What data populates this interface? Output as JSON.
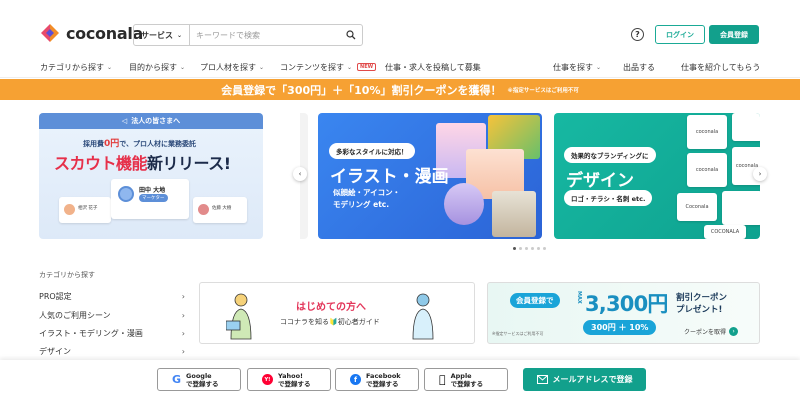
{
  "header": {
    "logo_text": "coconala",
    "search": {
      "select_label": "サービス",
      "placeholder": "キーワードで検索"
    },
    "help_label": "?",
    "login_label": "ログイン",
    "signup_label": "会員登録"
  },
  "nav": {
    "left_items": [
      "カテゴリから探す",
      "目的から探す",
      "プロ人材を探す",
      "コンテンツを探す"
    ],
    "new_badge": "NEW",
    "post_job": "仕事・求人を投稿して募集",
    "right_items": [
      "仕事を探す",
      "出品する",
      "仕事を紹介してもらう"
    ]
  },
  "promo": {
    "main": "会員登録で「300円」＋「10%」割引クーポンを獲得！",
    "note": "※指定サービスはご利用不可"
  },
  "carousel": {
    "slide1": {
      "header": "法人の皆さまへ",
      "sub_prefix": "採用費",
      "sub_red": "0円",
      "sub_suffix": "で、プロ人材に業務委託",
      "title_red": "スカウト機能",
      "title_black": "新リリース!",
      "profile_name": "田中 大地",
      "profile_role": "マーケター",
      "mini1_name": "相沢 花子",
      "mini2_name": "佐藤 大樹"
    },
    "slide2": {
      "pill": "多彩なスタイルに対応！",
      "title": "イラスト・漫画",
      "desc_line1": "似顔絵・アイコン・",
      "desc_line2": "モデリング etc."
    },
    "slide3": {
      "pill": "効果的なブランディングに",
      "title": "デザイン",
      "desc": "ロゴ・チラシ・名刺 etc.",
      "tiles": [
        "coconala",
        "coconala",
        "coconala",
        "Coconala",
        "COCONALA"
      ]
    },
    "prev_arrow": "‹",
    "next_arrow": "›",
    "dot_count": 6,
    "active_dot": 0
  },
  "categories": {
    "heading": "カテゴリから探す",
    "items": [
      "PRO認定",
      "人気のご利用シーン",
      "イラスト・モデリング・漫画",
      "デザイン"
    ]
  },
  "banner_beginner": {
    "title": "はじめての方へ",
    "sub": "ココナラを知る🔰初心者ガイド"
  },
  "banner_coupon": {
    "signup": "会員登録で",
    "max": "MAX",
    "amount": "3,300円",
    "coupon_line1": "割引クーポン",
    "coupon_line2": "プレゼント!",
    "breakdown": "300円 ＋ 10%",
    "note": "※指定サービスはご利用不可",
    "cta": "クーポンを取得"
  },
  "social": {
    "google": {
      "name": "Google",
      "action": "で登録する",
      "color": "#4285f4"
    },
    "yahoo": {
      "name": "Yahoo!",
      "action": "で登録する",
      "color": "#ff0033"
    },
    "facebook": {
      "name": "Facebook",
      "action": "で登録する",
      "color": "#1877f2"
    },
    "apple": {
      "name": "Apple",
      "action": "で登録する",
      "color": "#000000"
    },
    "mail": "メールアドレスで登録"
  },
  "colors": {
    "brand_green": "#12a08c",
    "promo_orange": "#f6a133",
    "accent_red": "#e6304a"
  }
}
